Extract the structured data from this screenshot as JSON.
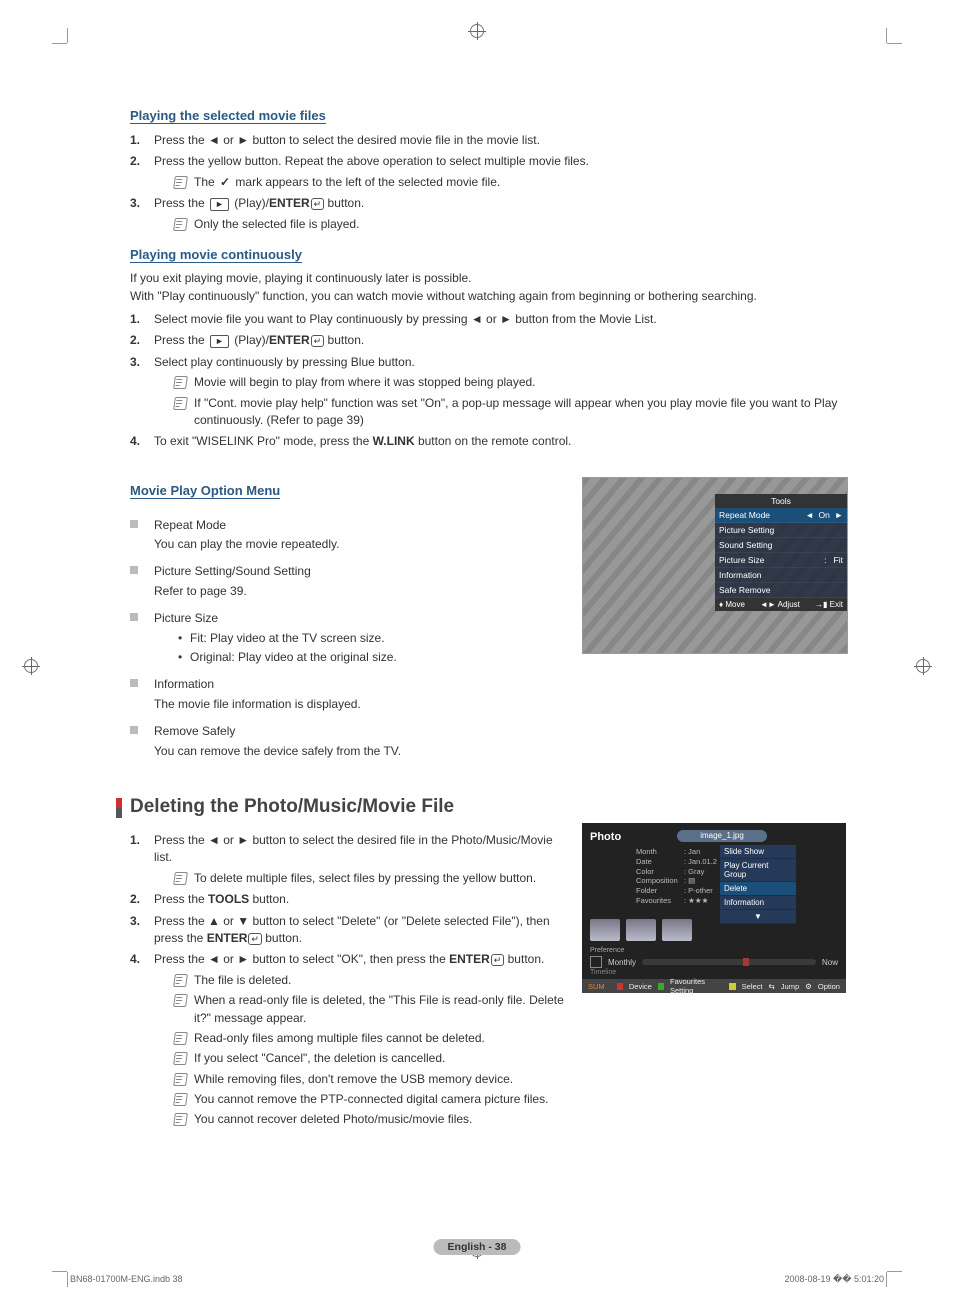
{
  "sections": {
    "playing_selected": {
      "title": "Playing the selected movie files",
      "step1": "Press the ◄ or ► button to select the desired movie file in the movie list.",
      "step2": "Press the yellow button. Repeat the above operation to select multiple movie files.",
      "note2": "The ✓ mark appears to the left of the selected movie file.",
      "step3_pre": "Press the ",
      "step3_play": "►",
      "step3_mid": " (Play)/",
      "step3_enter": "ENTER",
      "step3_post": " button.",
      "note3": "Only the selected file is played."
    },
    "playing_cont": {
      "title": "Playing movie continuously",
      "intro1": "If you exit playing movie, playing it continuously later is possible.",
      "intro2": "With \"Play continuously\" function, you can watch movie without watching again from beginning or bothering searching.",
      "step1": "Select movie file you want to Play continuously by pressing ◄ or ► button from the Movie List.",
      "step2_pre": "Press the ",
      "step2_play": "►",
      "step2_mid": " (Play)/",
      "step2_enter": "ENTER",
      "step2_post": " button.",
      "step3": "Select play continuously by pressing Blue button.",
      "note3a": "Movie will begin to play from where it was stopped being played.",
      "note3b": "If \"Cont. movie play help\" function was set \"On\", a pop-up message will appear when you play movie file you want to Play continuously. (Refer to page 39)",
      "step4_pre": "To exit \"WISELINK Pro\" mode, press the ",
      "step4_btn": "W.LINK",
      "step4_post": " button on the remote control."
    },
    "option_menu": {
      "title": "Movie Play Option Menu",
      "items": [
        {
          "head": "Repeat Mode",
          "desc": "You can play the movie repeatedly."
        },
        {
          "head": "Picture Setting/Sound Setting",
          "desc": "Refer to page 39."
        },
        {
          "head": "Picture Size",
          "bullets": [
            "Fit: Play video at the TV screen size.",
            "Original: Play video at the original size."
          ]
        },
        {
          "head": "Information",
          "desc": "The movie file information is displayed."
        },
        {
          "head": "Remove Safely",
          "desc": "You can remove the device safely from the TV."
        }
      ]
    },
    "deleting": {
      "title": "Deleting the Photo/Music/Movie File",
      "step1": "Press the ◄ or ► button to select the desired file in the Photo/Music/Movie list.",
      "note1": "To delete multiple files, select files by pressing the yellow button.",
      "step2_pre": "Press the ",
      "step2_btn": "TOOLS",
      "step2_post": " button.",
      "step3_pre": "Press the ▲ or ▼ button to select \"Delete\" (or \"Delete selected File\"), then press the ",
      "step3_btn": "ENTER",
      "step3_post": " button.",
      "step4_pre": "Press the ◄ or ► button to select \"OK\", then press the ",
      "step4_btn": "ENTER",
      "step4_post": " button.",
      "notes4": [
        "The file is deleted.",
        "When a read-only file is deleted, the \"This File is read-only file. Delete it?\" message appear.",
        "Read-only files among multiple files cannot be deleted.",
        "If you select \"Cancel\", the deletion is cancelled.",
        "While removing files, don't remove the USB memory device.",
        "You cannot remove the PTP-connected digital camera picture files.",
        "You cannot recover deleted Photo/music/movie files."
      ]
    }
  },
  "osd_tools": {
    "title": "Tools",
    "repeat": "Repeat Mode",
    "repeat_lt": "◄",
    "repeat_val": "On",
    "repeat_rt": "►",
    "picture": "Picture Setting",
    "sound": "Sound Setting",
    "size": "Picture Size",
    "size_sep": ":",
    "size_val": "Fit",
    "info": "Information",
    "remove": "Safe Remove",
    "move_icon": "♦",
    "move": "Move",
    "adjust_icon": "◄►",
    "adjust": "Adjust",
    "exit_icon": "→▮",
    "exit": "Exit"
  },
  "osd_photo": {
    "label": "Photo",
    "file": "image_1.jpg",
    "meta": [
      {
        "k": "Month",
        "v": ": Jan"
      },
      {
        "k": "Date",
        "v": ": Jan.01.2"
      },
      {
        "k": "Color",
        "v": ": Gray"
      },
      {
        "k": "Composition",
        "v": ": ▤"
      },
      {
        "k": "Folder",
        "v": ": P-other"
      },
      {
        "k": "Favourites",
        "v": ": ★★★"
      }
    ],
    "menu": [
      "Slide Show",
      "Play Current Group",
      "Delete",
      "Information"
    ],
    "menu_arrow": "▼",
    "pref": "Preference",
    "monthly": "Monthly",
    "now": "Now",
    "timeline": "Timeline",
    "sum": "SUM",
    "device_label": "Device",
    "fav_label": "Favourites Setting",
    "select_label": "Select",
    "jump_label": "Jump",
    "option_label": "Option"
  },
  "footer": {
    "page": "English - 38",
    "left": "BN68-01700M-ENG.indb   38",
    "right": "2008-08-19   �� 5:01:20"
  }
}
